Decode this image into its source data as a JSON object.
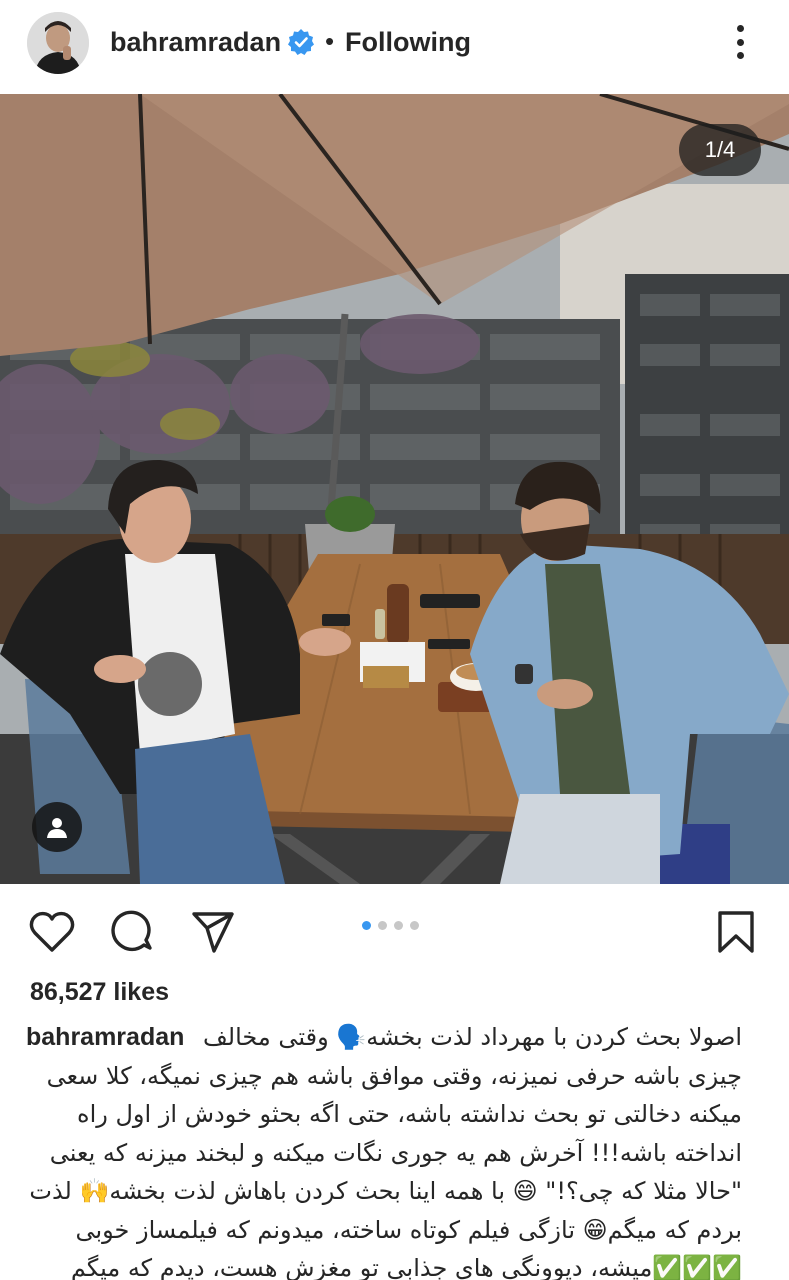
{
  "post": {
    "username": "bahramradan",
    "separator": "•",
    "follow_status": "Following",
    "image_counter": "1/4",
    "likes": "86,527 likes",
    "carousel": {
      "count": 4,
      "active_index": 0
    }
  },
  "caption": {
    "username": "bahramradan",
    "lines": [
      "اصولا بحث کردن با مهرداد لذت بخشه🗣️ وقتی مخالف",
      "چیزی باشه حرفی نمیزنه، وقتی موافق باشه هم چیزی نمیگه، کلا سعی",
      "میکنه دخالتی تو بحث نداشته باشه، حتی اگه بحثو خودش از اول راه",
      "انداخته باشه!!! آخرش هم یه جوری نگات میکنه و لبخند میزنه که یعنی",
      "\"حالا مثلا که چی؟!\" 😄 با همه اینا بحث کردن باهاش لذت بخشه🙌 لذت",
      "بردم که میگم😁 تازگی فیلم کوتاه ساخته، میدونم که فیلمساز خوبی",
      "✅✅✅میشه، دیوونگی های جذابی تو مغزش هست، دیدم که میگم"
    ]
  },
  "colors": {
    "text": "#262626",
    "verified": "#3897f0",
    "dot_active": "#3897f0",
    "dot_inactive": "#c7c7c7"
  },
  "icons": [
    "more-options-icon",
    "verified-badge-icon",
    "heart-icon",
    "comment-icon",
    "share-icon",
    "bookmark-icon",
    "user-tag-icon"
  ]
}
